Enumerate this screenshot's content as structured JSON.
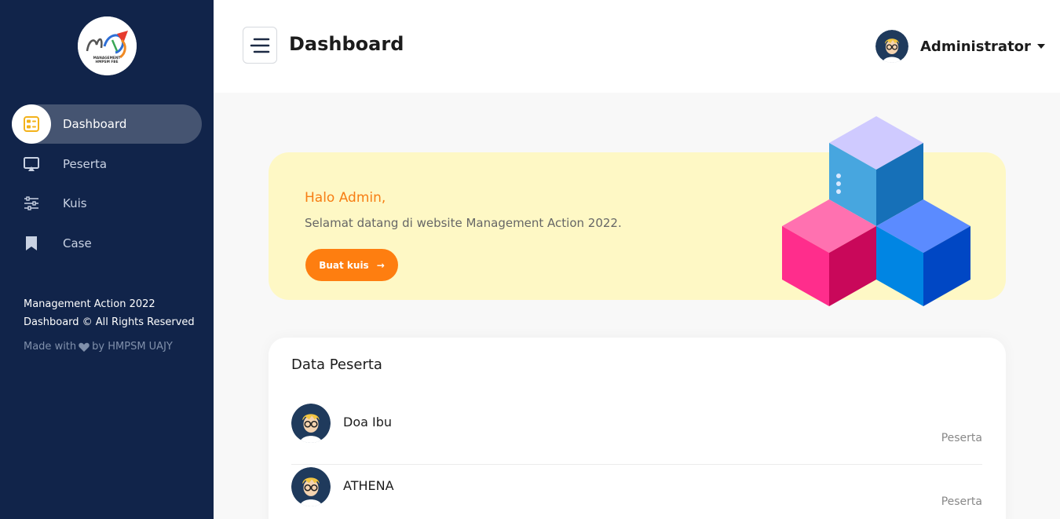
{
  "logo": {
    "text": "MANAGEMENT HMPSM FBE",
    "icon": "management-action-logo"
  },
  "sidebar": {
    "items": [
      {
        "label": "Dashboard",
        "icon": "dashboard-icon",
        "active": true
      },
      {
        "label": "Peserta",
        "icon": "presentation-icon",
        "active": false
      },
      {
        "label": "Kuis",
        "icon": "sliders-icon",
        "active": false
      },
      {
        "label": "Case",
        "icon": "bookmark-icon",
        "active": false
      }
    ],
    "footer_line1": "Management Action 2022",
    "footer_line2": "Dashboard © All Rights Reserved",
    "made_with_prefix": "Made with",
    "made_with_suffix": "by HMPSM UAJY"
  },
  "header": {
    "title": "Dashboard",
    "user_name": "Administrator"
  },
  "banner": {
    "greeting": "Halo Admin,",
    "welcome": "Selamat datang di website Management Action 2022.",
    "cta_label": "Buat kuis",
    "cta_arrow": "→"
  },
  "peserta": {
    "title": "Data Peserta",
    "rows": [
      {
        "name": "Doa Ibu",
        "role": "Peserta"
      },
      {
        "name": "ATHENA",
        "role": "Peserta"
      }
    ]
  },
  "colors": {
    "sidebar_bg": "#11244a",
    "accent_orange": "#fe7e10",
    "banner_bg": "#fef8c5",
    "dashboard_icon": "#f3b21b"
  }
}
